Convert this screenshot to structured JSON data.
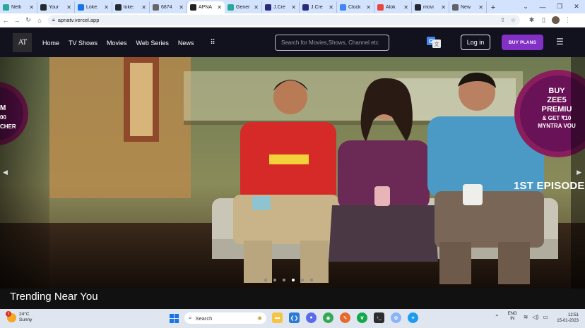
{
  "browser": {
    "tabs": [
      {
        "label": "Netli",
        "fav_color": "#27a89a"
      },
      {
        "label": "Your",
        "fav_color": "#24292f"
      },
      {
        "label": "Loke:",
        "fav_color": "#1a73e8"
      },
      {
        "label": "loke:",
        "fav_color": "#24292f"
      },
      {
        "label": "6874",
        "fav_color": "#666666"
      },
      {
        "label": "APNA",
        "fav_color": "#222222",
        "active": true
      },
      {
        "label": "Gener",
        "fav_color": "#27a89a"
      },
      {
        "label": "J.Cre",
        "fav_color": "#2a2a7a"
      },
      {
        "label": "J.Cre",
        "fav_color": "#2a2a7a"
      },
      {
        "label": "Clock",
        "fav_color": "#4285f4"
      },
      {
        "label": "Alok",
        "fav_color": "#e8453c"
      },
      {
        "label": "movi",
        "fav_color": "#24292f"
      },
      {
        "label": "New",
        "fav_color": "#5f6368"
      }
    ],
    "url": "apnatv.vercel.app"
  },
  "header": {
    "logo_text": "AT",
    "nav": [
      "Home",
      "TV Shows",
      "Movies",
      "Web Series",
      "News"
    ],
    "search_placeholder": "Search for Movies,Shows, Channel etc",
    "login_label": "Log in",
    "buy_label": "BUY PLANS"
  },
  "hero": {
    "promo_right": [
      "BUY",
      "ZEE5",
      "PREMIU",
      "& GET ₹10",
      "MYNTRA VOU"
    ],
    "promo_left": [
      "M",
      "00",
      "CHER"
    ],
    "episode_label": "1ST EPISODE",
    "dots_total": 6,
    "dots_active": 3
  },
  "section": {
    "title": "Trending Near You"
  },
  "taskbar": {
    "weather_temp": "24°C",
    "weather_desc": "Sunny",
    "weather_badge": "1",
    "search_label": "Search",
    "lang_top": "ENG",
    "lang_bottom": "IN",
    "time": "12:51",
    "date": "15-01-2023"
  }
}
